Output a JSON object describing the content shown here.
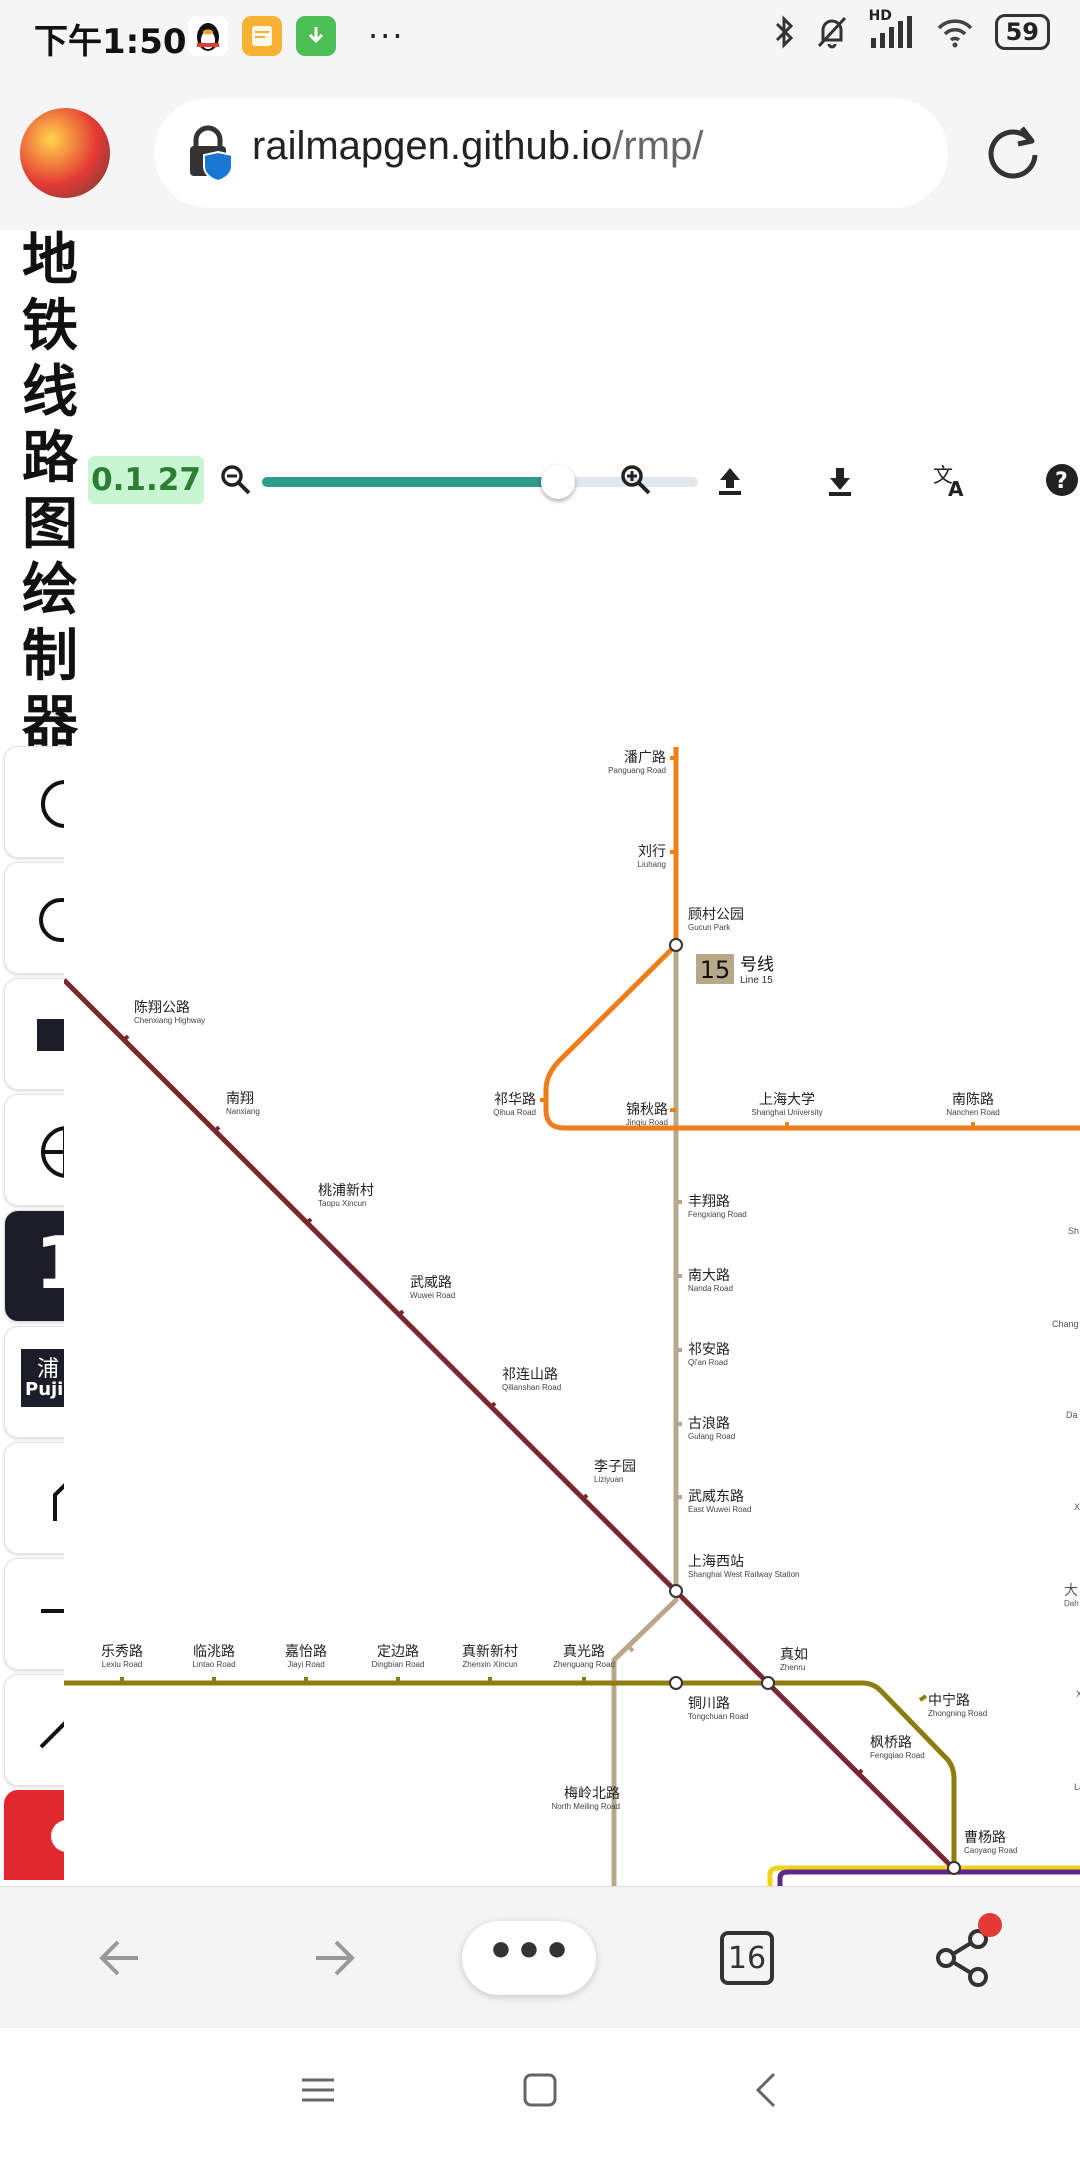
{
  "status_bar": {
    "time": "下午1:50",
    "more": "···",
    "battery": "59",
    "signal_label": "HD"
  },
  "browser": {
    "url_host": "railmapgen.github.io",
    "url_path": "/rmp/"
  },
  "app": {
    "title_chars": [
      "地",
      "铁",
      "线",
      "路",
      "图",
      "绘",
      "制",
      "器"
    ],
    "version": "0.1.27",
    "zoom_percent": 68
  },
  "tools": {
    "items": [
      {
        "name": "circle-station-tool"
      },
      {
        "name": "labelled-station-tool"
      },
      {
        "name": "square-tool"
      },
      {
        "name": "interchange-tool"
      },
      {
        "name": "line-badge-tool",
        "text": "1"
      },
      {
        "name": "station-name-tool",
        "text": "浦",
        "subtext": "Pujia"
      },
      {
        "name": "diagonal-line-tool"
      },
      {
        "name": "straight-line-tool"
      },
      {
        "name": "slash-line-tool"
      },
      {
        "name": "red-tool"
      }
    ]
  },
  "map": {
    "line_badge": {
      "num": "15",
      "zh": "号线",
      "en": "Line 15",
      "color": "#b8a88a"
    },
    "colors": {
      "line15": "#b8a88a",
      "orange": "#ef7d1a",
      "maroon": "#7b2630",
      "olive": "#8d7c0e",
      "purple": "#5b2a86",
      "yellow": "#f2d21b"
    },
    "stations": [
      {
        "zh": "潘广路",
        "en": "Panguang Road"
      },
      {
        "zh": "刘行",
        "en": "Liuhang"
      },
      {
        "zh": "顾村公园",
        "en": "Gucun Park"
      },
      {
        "zh": "陈翔公路",
        "en": "Chenxiang Highway"
      },
      {
        "zh": "南翔",
        "en": "Nanxiang"
      },
      {
        "zh": "祁华路",
        "en": "Qihua Road"
      },
      {
        "zh": "锦秋路",
        "en": "Jinqiu Road"
      },
      {
        "zh": "上海大学",
        "en": "Shanghai University"
      },
      {
        "zh": "南陈路",
        "en": "Nanchen Road"
      },
      {
        "zh": "桃浦新村",
        "en": "Taopu Xincun"
      },
      {
        "zh": "丰翔路",
        "en": "Fengxiang Road"
      },
      {
        "zh": "武威路",
        "en": "Wuwei Road"
      },
      {
        "zh": "南大路",
        "en": "Nanda Road"
      },
      {
        "zh": "祁连山路",
        "en": "Qilianshan Road"
      },
      {
        "zh": "祁安路",
        "en": "Qi'an Road"
      },
      {
        "zh": "古浪路",
        "en": "Gulang Road"
      },
      {
        "zh": "李子园",
        "en": "Liziyuan"
      },
      {
        "zh": "武威东路",
        "en": "East Wuwei Road"
      },
      {
        "zh": "上海西站",
        "en": "Shanghai West Railway Station"
      },
      {
        "zh": "乐秀路",
        "en": "Lexiu Road"
      },
      {
        "zh": "临洮路",
        "en": "Lintao Road"
      },
      {
        "zh": "嘉怡路",
        "en": "Jiayi Road"
      },
      {
        "zh": "定边路",
        "en": "Dingbian Road"
      },
      {
        "zh": "真新新村",
        "en": "Zhenxin Xincun"
      },
      {
        "zh": "真光路",
        "en": "Zhenguang Road"
      },
      {
        "zh": "真如",
        "en": "Zhenru"
      },
      {
        "zh": "铜川路",
        "en": "Tongchuan Road"
      },
      {
        "zh": "中宁路",
        "en": "Zhongning Road"
      },
      {
        "zh": "枫桥路",
        "en": "Fengqiao Road"
      },
      {
        "zh": "梅岭北路",
        "en": "North Meiling Road"
      },
      {
        "zh": "曹杨路",
        "en": "Caoyang Road"
      }
    ],
    "edge_fragments": [
      "Sh",
      "Chang",
      "Da",
      "X",
      "大",
      "Dah",
      "X",
      "La"
    ]
  },
  "bottom_bar": {
    "more": "•••",
    "tab_count": "16"
  }
}
